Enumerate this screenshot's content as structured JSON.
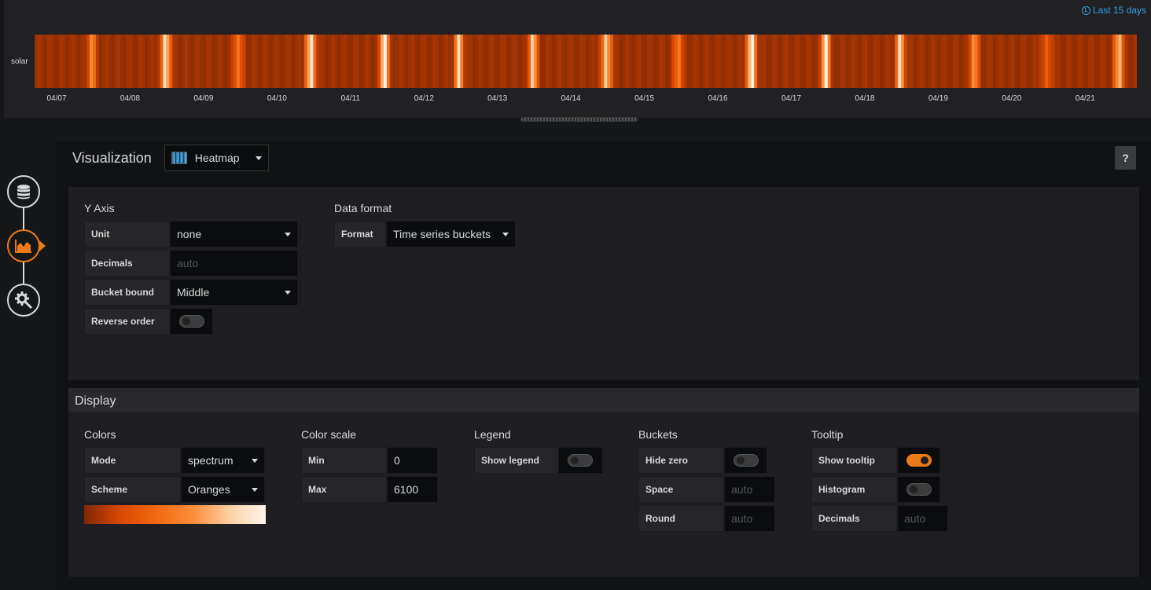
{
  "time_range": "Last 15 days",
  "chart_data": {
    "type": "heatmap",
    "series": [
      {
        "name": "solar"
      }
    ],
    "x_ticks": [
      "04/07",
      "04/08",
      "04/09",
      "04/10",
      "04/11",
      "04/12",
      "04/13",
      "04/14",
      "04/15",
      "04/16",
      "04/17",
      "04/18",
      "04/19",
      "04/20",
      "04/21"
    ],
    "color_scheme": "Oranges",
    "color_scale": {
      "min": 0,
      "max": 6100
    }
  },
  "visualization": {
    "title": "Visualization",
    "selected": "Heatmap",
    "help": "?"
  },
  "y_axis": {
    "title": "Y Axis",
    "unit_label": "Unit",
    "unit_value": "none",
    "decimals_label": "Decimals",
    "decimals_placeholder": "auto",
    "bucket_bound_label": "Bucket bound",
    "bucket_bound_value": "Middle",
    "reverse_label": "Reverse order",
    "reverse_on": false
  },
  "data_format": {
    "title": "Data format",
    "format_label": "Format",
    "format_value": "Time series buckets"
  },
  "display": {
    "title": "Display",
    "colors": {
      "title": "Colors",
      "mode_label": "Mode",
      "mode_value": "spectrum",
      "scheme_label": "Scheme",
      "scheme_value": "Oranges"
    },
    "color_scale": {
      "title": "Color scale",
      "min_label": "Min",
      "min_value": "0",
      "max_label": "Max",
      "max_value": "6100"
    },
    "legend": {
      "title": "Legend",
      "show_label": "Show legend",
      "show_on": false
    },
    "buckets": {
      "title": "Buckets",
      "hide_zero_label": "Hide zero",
      "hide_zero_on": false,
      "space_label": "Space",
      "space_placeholder": "auto",
      "round_label": "Round",
      "round_placeholder": "auto"
    },
    "tooltip": {
      "title": "Tooltip",
      "show_label": "Show tooltip",
      "show_on": true,
      "histogram_label": "Histogram",
      "histogram_on": false,
      "decimals_label": "Decimals",
      "decimals_placeholder": "auto"
    }
  }
}
